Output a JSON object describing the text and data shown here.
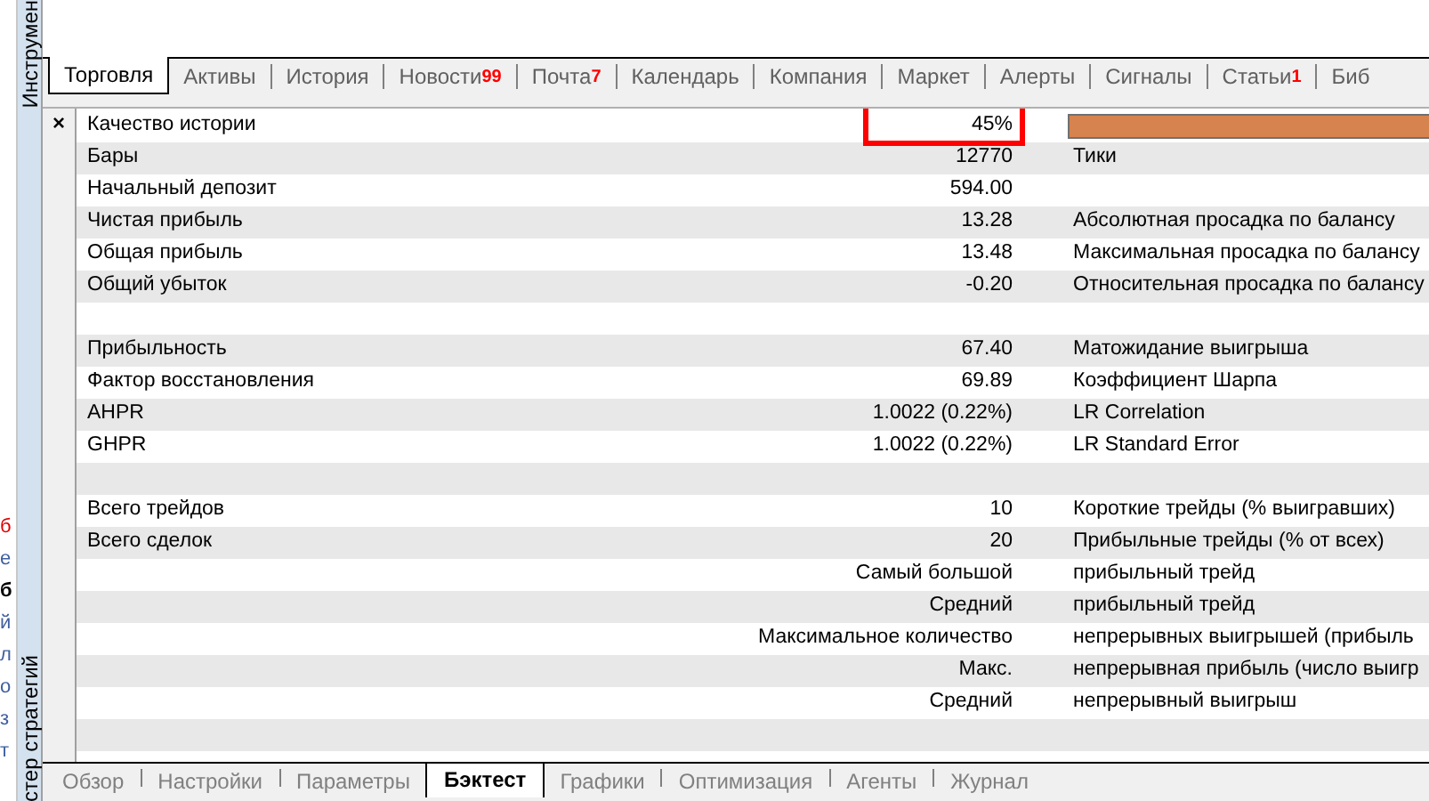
{
  "side_panel": {
    "top_label": "Инструмен",
    "bottom_label": "стер стратегий",
    "close": "×"
  },
  "left_fragments": [
    {
      "text": "б",
      "kind": "alert"
    },
    {
      "text": "е",
      "kind": "link"
    },
    {
      "text": "б",
      "kind": "bold"
    },
    {
      "text": "й",
      "kind": "link"
    },
    {
      "text": "л",
      "kind": "link"
    },
    {
      "text": "о",
      "kind": "link"
    },
    {
      "text": "з",
      "kind": "link"
    },
    {
      "text": "т",
      "kind": "link"
    }
  ],
  "tabs": [
    {
      "label": "Торговля",
      "selected": true
    },
    {
      "label": "Активы",
      "selected": false
    },
    {
      "label": "История",
      "selected": false
    },
    {
      "label": "Новости",
      "badge": "99",
      "selected": false
    },
    {
      "label": "Почта",
      "badge": "7",
      "selected": false
    },
    {
      "label": "Календарь",
      "selected": false
    },
    {
      "label": "Компания",
      "selected": false
    },
    {
      "label": "Маркет",
      "selected": false
    },
    {
      "label": "Алерты",
      "selected": false
    },
    {
      "label": "Сигналы",
      "selected": false
    },
    {
      "label": "Статьи",
      "badge": "1",
      "selected": false
    },
    {
      "label": "Биб",
      "selected": false
    }
  ],
  "report": {
    "quality": {
      "label": "Качество истории",
      "value": "45%",
      "level": 0.45,
      "highlighted": true
    },
    "rows": [
      {
        "label": "Бары",
        "value": "12770",
        "label2": "Тики"
      },
      {
        "label": "Начальный депозит",
        "value": "594.00"
      },
      {
        "label": "Чистая прибыль",
        "value": "13.28",
        "label2": "Абсолютная просадка по балансу"
      },
      {
        "label": "Общая прибыль",
        "value": "13.48",
        "label2": "Максимальная просадка по балансу"
      },
      {
        "label": "Общий убыток",
        "value": "-0.20",
        "label2": "Относительная просадка по балансу"
      },
      {},
      {
        "label": "Прибыльность",
        "value": "67.40",
        "label2": "Матожидание выигрыша"
      },
      {
        "label": "Фактор восстановления",
        "value": "69.89",
        "label2": "Коэффициент Шарпа"
      },
      {
        "label": "AHPR",
        "value": "1.0022 (0.22%)",
        "label2": "LR Correlation"
      },
      {
        "label": "GHPR",
        "value": "1.0022 (0.22%)",
        "label2": "LR Standard Error"
      },
      {},
      {
        "label": "Всего трейдов",
        "value": "10",
        "label2": "Короткие трейды (% выигравших)"
      },
      {
        "label": "Всего сделок",
        "value": "20",
        "label2": "Прибыльные трейды (% от всех)"
      },
      {
        "value": "Самый большой",
        "label2": "прибыльный трейд"
      },
      {
        "value": "Средний",
        "label2": "прибыльный трейд"
      },
      {
        "value": "Максимальное количество",
        "label2": "непрерывных выигрышей (прибыль"
      },
      {
        "value": "Макс.",
        "label2": "непрерывная прибыль (число выигр"
      },
      {
        "value": "Средний",
        "label2": "непрерывный выигрыш"
      },
      {}
    ]
  },
  "bottom_tabs": [
    {
      "label": "Обзор",
      "selected": false
    },
    {
      "label": "Настройки",
      "selected": false
    },
    {
      "label": "Параметры",
      "selected": false
    },
    {
      "label": "Бэктест",
      "selected": true
    },
    {
      "label": "Графики",
      "selected": false
    },
    {
      "label": "Оптимизация",
      "selected": false
    },
    {
      "label": "Агенты",
      "selected": false
    },
    {
      "label": "Журнал",
      "selected": false
    }
  ]
}
